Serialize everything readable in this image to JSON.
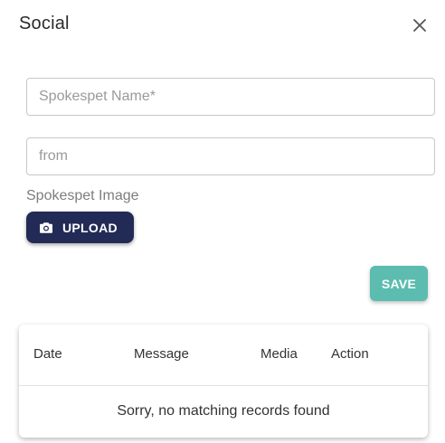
{
  "dialog": {
    "title": "Social",
    "close_icon": "close-icon"
  },
  "form": {
    "name_placeholder": "Spokespet Name*",
    "name_value": "",
    "from_placeholder": "from",
    "from_value": "",
    "image_label": "Spokespet Image",
    "upload_label": "UPLOAD",
    "upload_icon": "camera-icon",
    "save_label": "SAVE"
  },
  "table": {
    "columns": [
      "Date",
      "Message",
      "Media",
      "Action"
    ],
    "empty_message": "Sorry, no matching records found"
  },
  "colors": {
    "upload_bg": "#222b56",
    "save_bg": "#5bbcaf"
  }
}
